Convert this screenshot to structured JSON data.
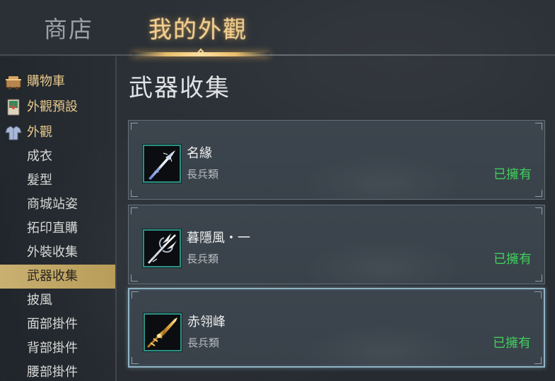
{
  "tabs": [
    {
      "label": "商店",
      "active": false
    },
    {
      "label": "我的外觀",
      "active": true
    }
  ],
  "sidebar": {
    "items": [
      {
        "label": "購物車",
        "icon": "cart-icon",
        "section": true
      },
      {
        "label": "外觀預設",
        "icon": "preset-scroll-icon",
        "section": true
      },
      {
        "label": "外觀",
        "icon": "armor-icon",
        "section": true
      },
      {
        "label": "成衣"
      },
      {
        "label": "髮型"
      },
      {
        "label": "商城站姿"
      },
      {
        "label": "拓印直購"
      },
      {
        "label": "外裝收集"
      },
      {
        "label": "武器收集",
        "active": true
      },
      {
        "label": "披風"
      },
      {
        "label": "面部掛件"
      },
      {
        "label": "背部掛件"
      },
      {
        "label": "腰部掛件"
      }
    ]
  },
  "main": {
    "title": "武器收集",
    "items": [
      {
        "name": "名緣",
        "type": "長兵類",
        "status": "已擁有",
        "icon": "polearm-blade-icon",
        "selected": false
      },
      {
        "name": "暮隱風・一",
        "type": "長兵類",
        "status": "已擁有",
        "icon": "trident-icon",
        "selected": false
      },
      {
        "name": "赤翎峰",
        "type": "長兵類",
        "status": "已擁有",
        "icon": "golden-spear-icon",
        "selected": true
      }
    ]
  },
  "colors": {
    "accent_gold": "#f3cf8f",
    "owned_green": "#3fcf5c",
    "active_row": "#c9b071",
    "selected_border": "#8fb4c6"
  }
}
